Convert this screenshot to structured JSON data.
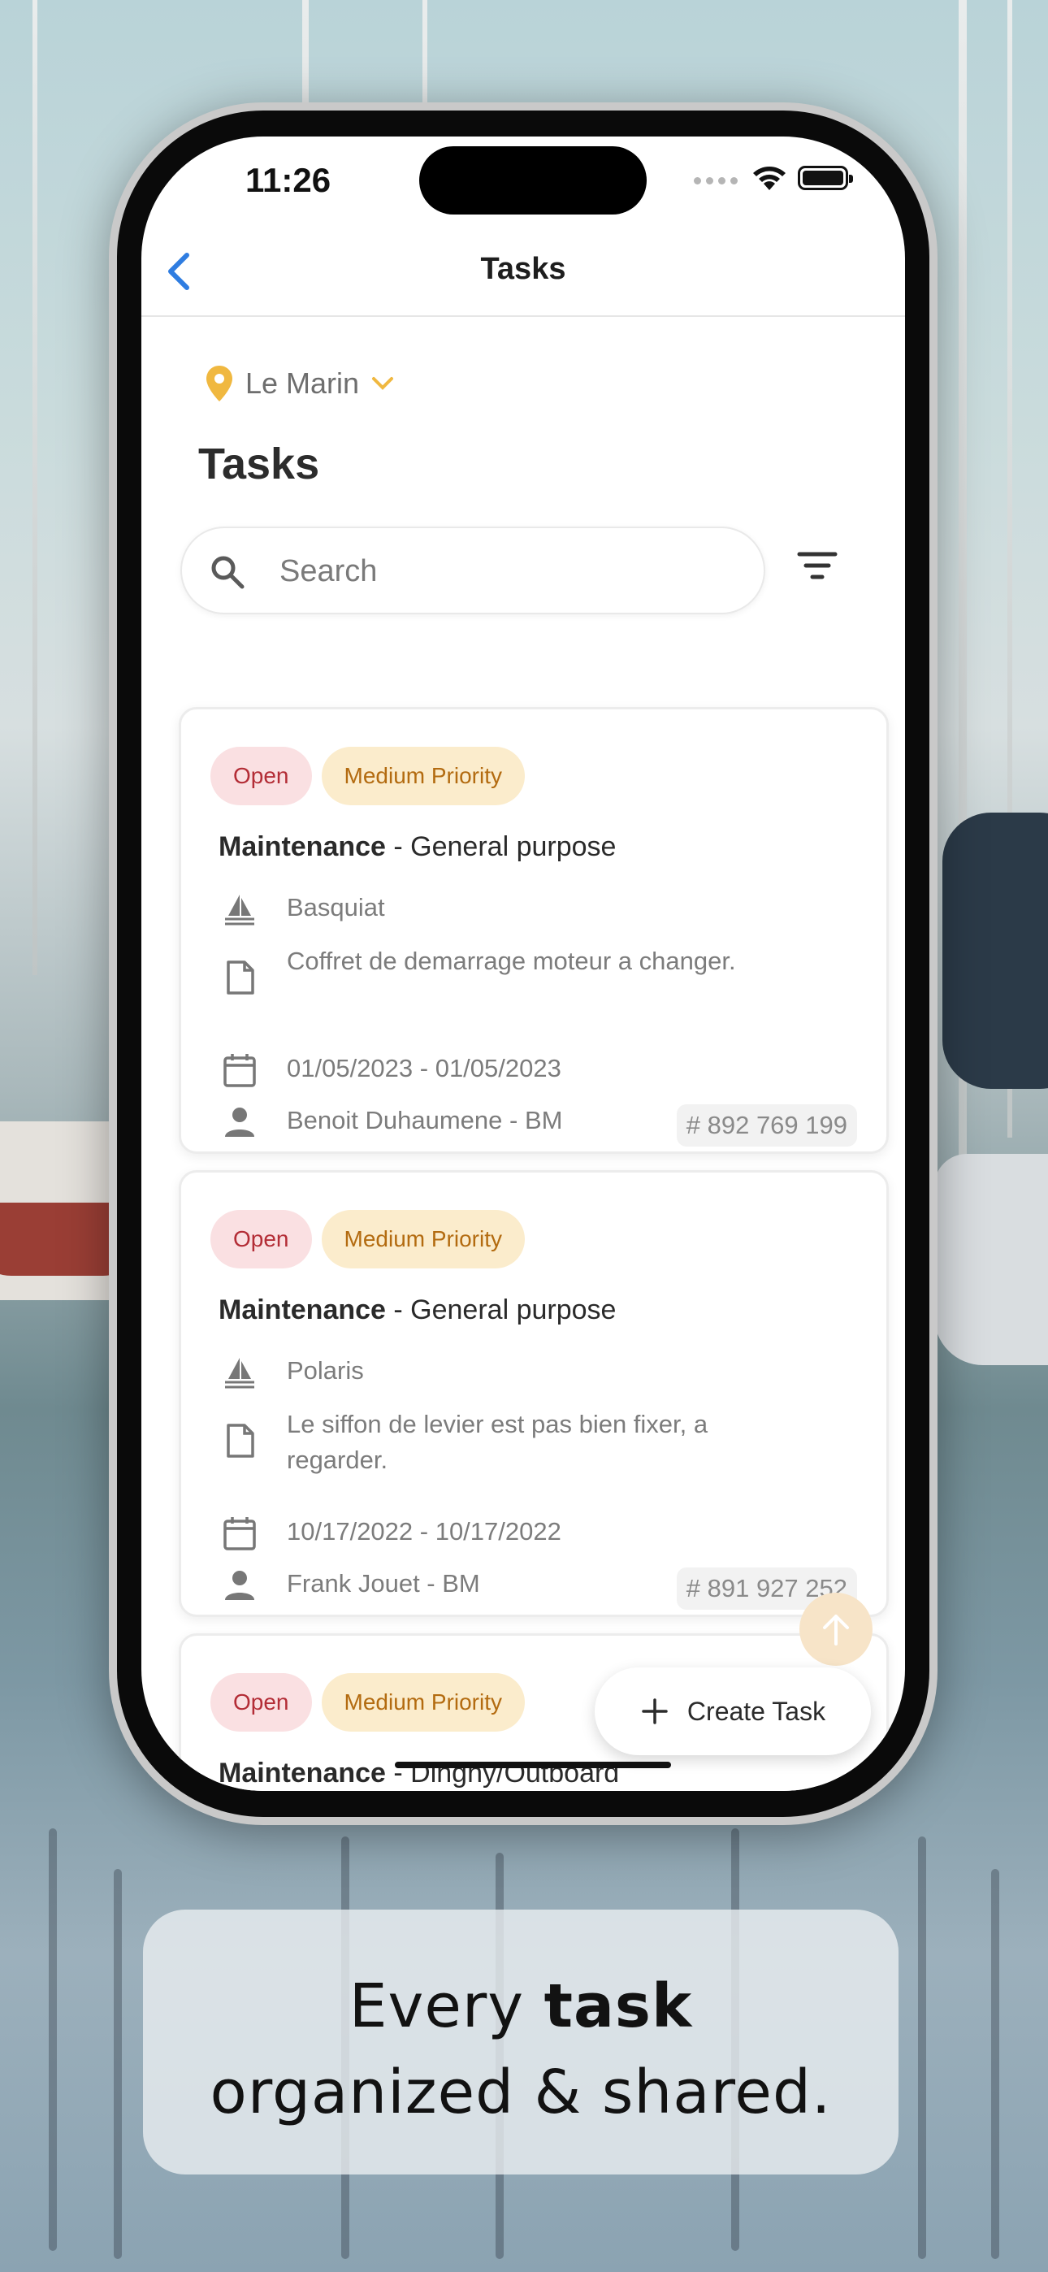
{
  "status_bar": {
    "time": "11:26"
  },
  "nav": {
    "title": "Tasks"
  },
  "location": {
    "label": "Le Marin"
  },
  "page_title": "Tasks",
  "search": {
    "placeholder": "Search"
  },
  "colors": {
    "accent": "#f0b840",
    "back": "#2f7de1",
    "open_bg": "#fae0e2",
    "open_fg": "#b32d36",
    "priority_bg": "#fbeccc",
    "priority_fg": "#b36b10"
  },
  "tasks": [
    {
      "status": "Open",
      "priority": "Medium Priority",
      "category": "Maintenance",
      "subcategory": " - General purpose",
      "boat": "Basquiat",
      "description": "Coffret de demarrage moteur a changer.",
      "dates": "01/05/2023 - 01/05/2023",
      "assignee": "Benoit Duhaumene - BM",
      "ticket": "# 892 769 199"
    },
    {
      "status": "Open",
      "priority": "Medium Priority",
      "category": "Maintenance",
      "subcategory": " - General purpose",
      "boat": "Polaris",
      "description": "Le siffon de levier est pas bien fixer, a regarder.",
      "dates": "10/17/2022 - 10/17/2022",
      "assignee": "Frank Jouet - BM",
      "ticket": "# 891 927 252"
    },
    {
      "status": "Open",
      "priority": "Medium Priority",
      "category": "Maintenance",
      "subcategory": " - Dinghy/Outboard"
    }
  ],
  "actions": {
    "create_task": "Create Task"
  },
  "caption": {
    "line1_pre": "Every ",
    "line1_bold": "task",
    "line2": "organized & shared."
  }
}
